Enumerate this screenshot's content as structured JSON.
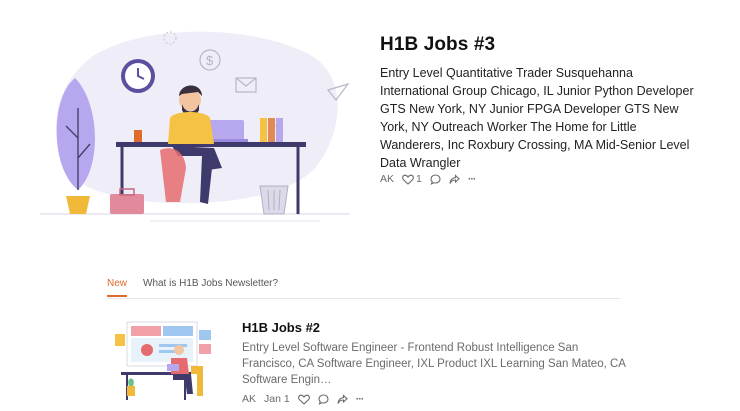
{
  "hero": {
    "title": "H1B Jobs #3",
    "excerpt": "Entry Level Quantitative Trader Susquehanna International Group Chicago, IL Junior Python Developer GTS New York, NY Junior FPGA Developer GTS New York, NY Outreach Worker The Home for Little Wanderers, Inc Roxbury Crossing, MA Mid-Senior Level Data Wrangler",
    "author": "AK",
    "likes": "1",
    "more": "···"
  },
  "tabs": {
    "new_label": "New",
    "what_label": "What is H1B Jobs Newsletter?"
  },
  "post": {
    "title": "H1B Jobs #2",
    "excerpt": "Entry Level Software Engineer - Frontend Robust Intelligence San Francisco, CA Software Engineer, IXL Product IXL Learning San Mateo, CA Software Engin…",
    "author": "AK",
    "date": "Jan 1",
    "more": "···"
  },
  "colors": {
    "accent": "#e06a2c",
    "illustration_bg": "#efedf7",
    "purple": "#b7a7ef",
    "shirt": "#f6c244"
  }
}
